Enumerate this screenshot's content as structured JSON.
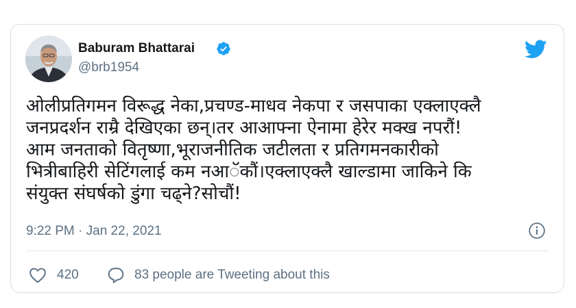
{
  "author": {
    "name": "Baburam Bhattarai",
    "handle": "@brb1954",
    "verified_icon": "verified-badge-icon",
    "avatar": "profile-photo"
  },
  "brand": {
    "icon": "twitter-bird-icon",
    "color": "#1da1f2"
  },
  "tweet": {
    "text": "ओलीप्रतिगमन विरूद्ध नेका,प्रचण्ड-माधव नेकपा र जसपाका एक्लाएक्लै\nजनप्रदर्शन राम्रै देखिएका छन्।तर आआफ्ना ऐनामा हेरेर मक्ख नपरौं!\nआम जनताको वितृष्णा,भूराजनीतिक जटीलता र प्रतिगमनकारीको\nभित्रीबाहिरी सेटिंगलाई कम नआॅकौं।एक्लाएक्लै खाल्डामा जाकिने कि\nसंयुक्त संघर्षको डुंगा चढ्ने?सोचौं!",
    "timestamp": "9:22 PM · Jan 22, 2021"
  },
  "actions": {
    "like_icon": "heart-icon",
    "like_count": "420",
    "conversation_icon": "speech-bubble-icon",
    "conversation_text": "83 people are Tweeting about this",
    "info_icon": "info-icon"
  },
  "colors": {
    "text": "#14171a",
    "secondary": "#5b7083",
    "border": "#d9dde1",
    "accent": "#1da1f2"
  }
}
